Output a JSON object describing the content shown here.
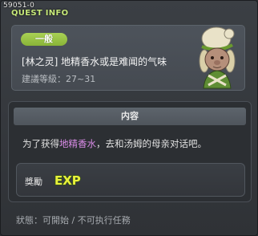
{
  "quest_id": "59051-0",
  "window_title": "QUEST INFO",
  "quest": {
    "category": "一般",
    "name": "[林之灵] 地精香水或是难闻的气味",
    "level_range": "建議等級：27~31"
  },
  "content": {
    "header": "内容",
    "description_before": "为了获得",
    "item_name": "地精香水",
    "description_after": "，去和汤姆的母亲对话吧。"
  },
  "reward": {
    "label": "獎勵",
    "exp_text": "EXP"
  },
  "status": "狀態：可開始 / 不可执行任務",
  "colors": {
    "accent_green": "#a9d155",
    "title_green": "#c7e97a",
    "item_purple": "#d88be6",
    "exp_yellow": "#e9f23b"
  },
  "icons": {
    "npc": "npc-portrait-icon",
    "reward": "exp-icon"
  }
}
